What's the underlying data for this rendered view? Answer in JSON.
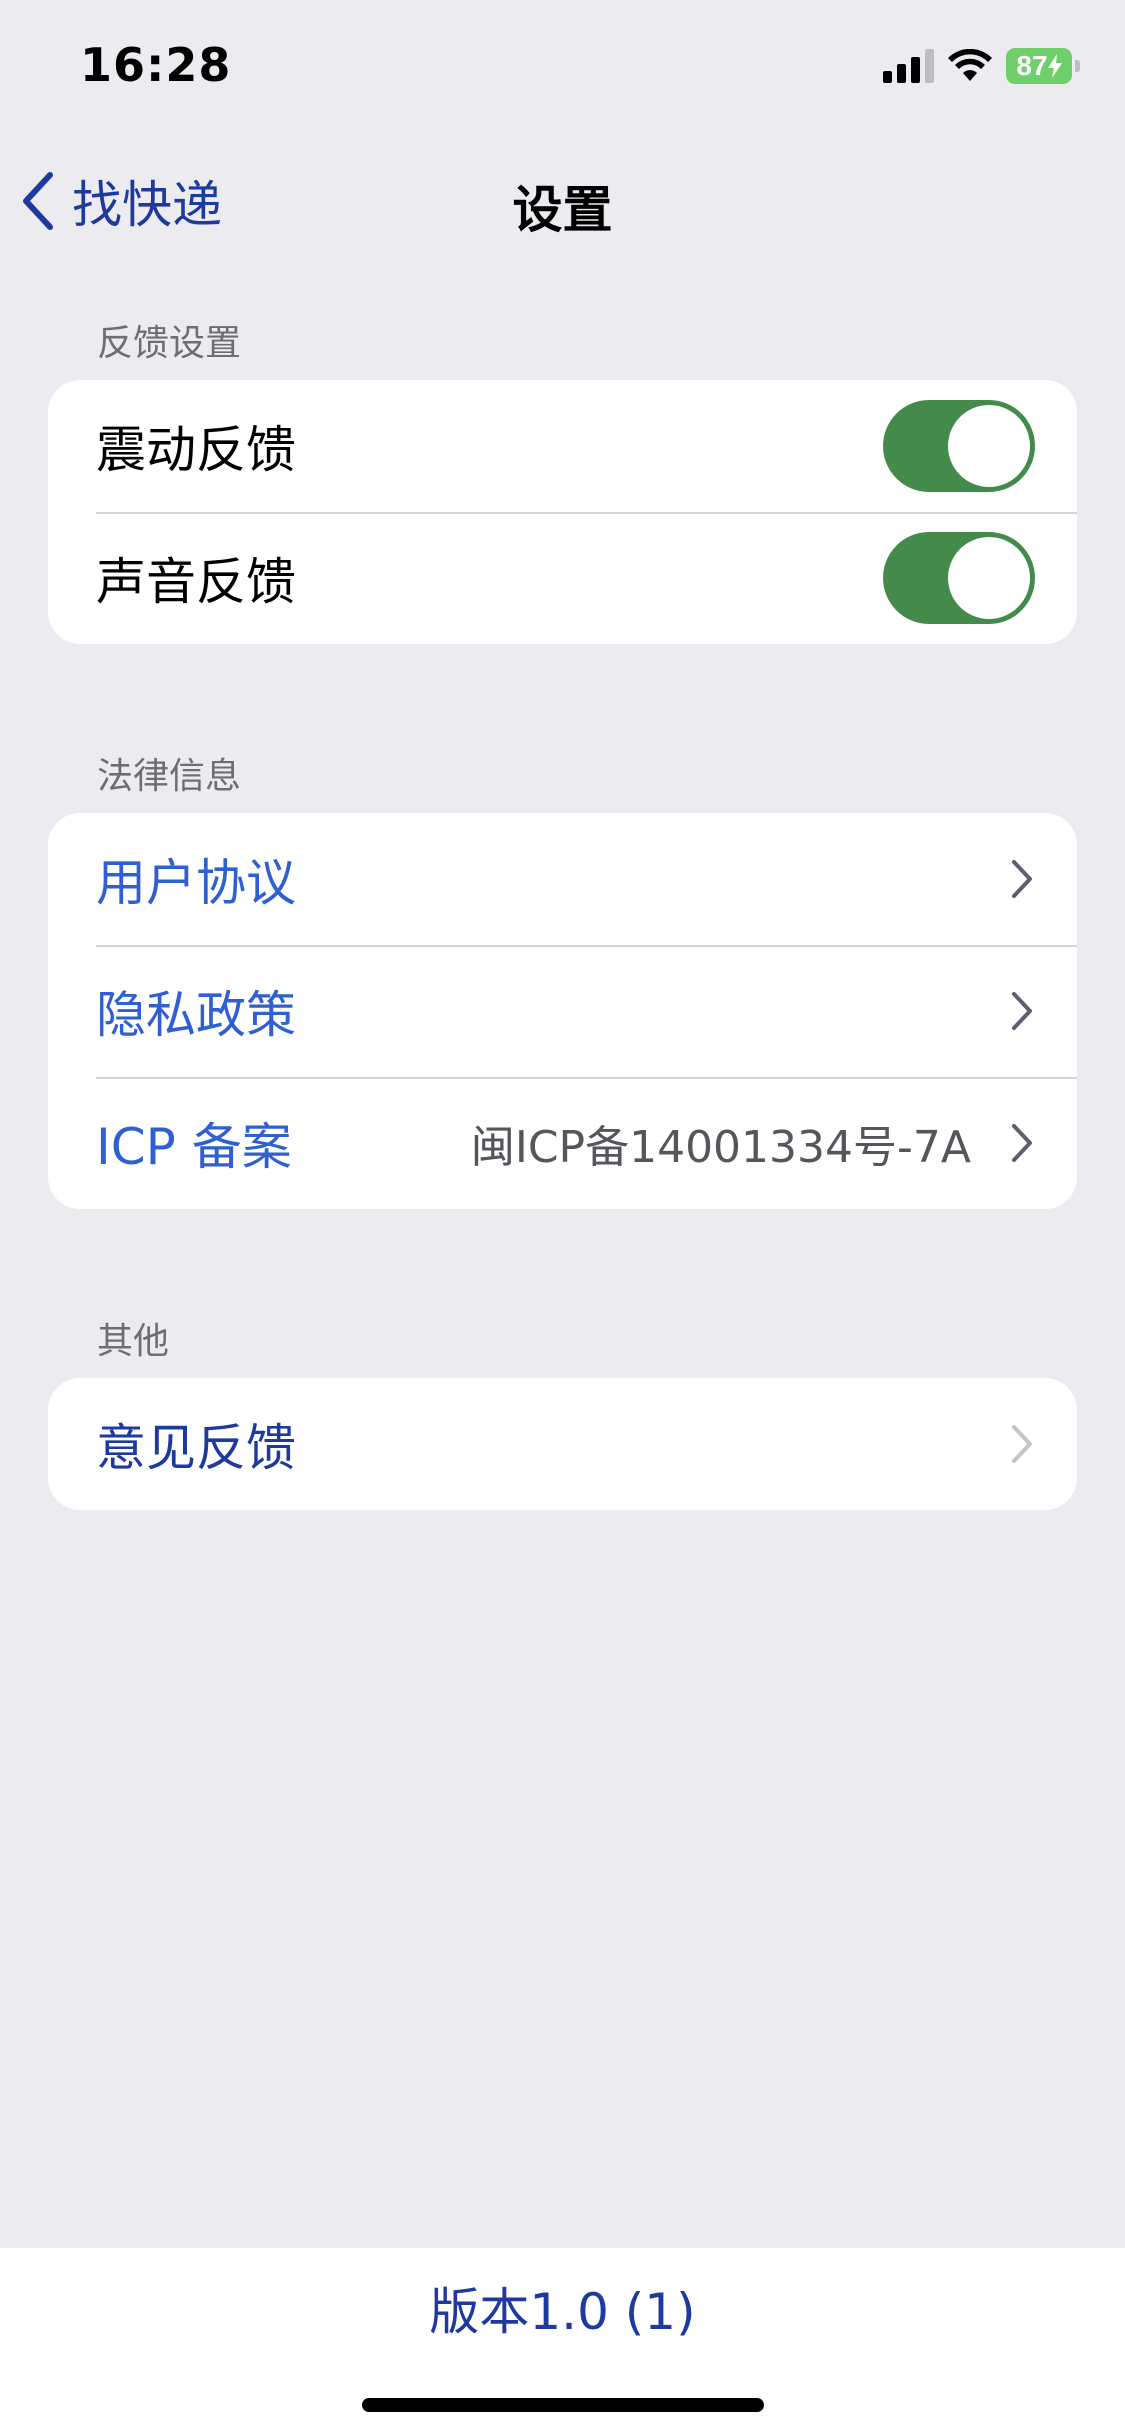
{
  "status_bar": {
    "time": "16:28",
    "battery": "87"
  },
  "nav": {
    "back_label": "找快递",
    "title": "设置"
  },
  "sections": {
    "feedback": {
      "header": "反馈设置",
      "vibration_label": "震动反馈",
      "vibration_on": true,
      "sound_label": "声音反馈",
      "sound_on": true
    },
    "legal": {
      "header": "法律信息",
      "user_agreement": "用户协议",
      "privacy_policy": "隐私政策",
      "icp_label": "ICP 备案",
      "icp_value": "闽ICP备14001334号-7A"
    },
    "other": {
      "header": "其他",
      "feedback_label": "意见反馈"
    }
  },
  "footer": {
    "version": "版本1.0 (1)"
  },
  "colors": {
    "background": "#EBEBF0",
    "toggle_on": "#448A4A",
    "link_blue": "#2F5FD1",
    "navy": "#1E3A9E"
  },
  "icons": {
    "back": "chevron-left-icon",
    "disclosure": "chevron-right-icon",
    "signal": "cellular-signal-icon",
    "wifi": "wifi-icon",
    "battery": "battery-charging-icon"
  }
}
